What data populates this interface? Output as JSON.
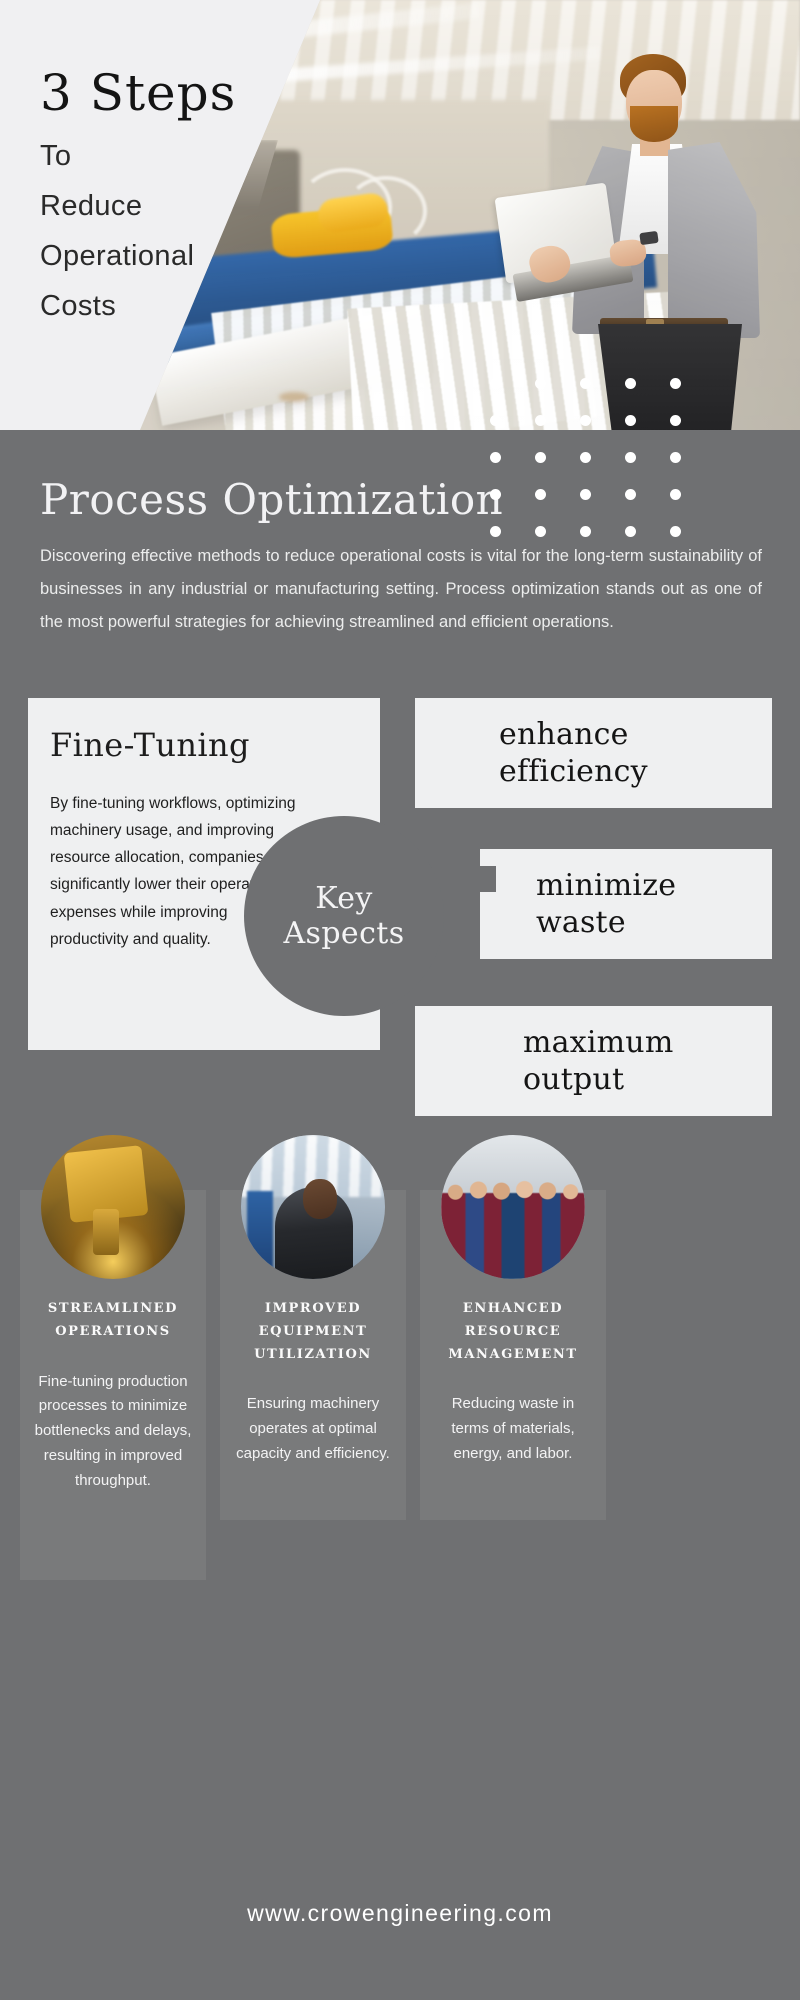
{
  "hero": {
    "title_main": "3 Steps",
    "title_lines": [
      "To",
      "Reduce",
      "Operational",
      "Costs"
    ],
    "photo_alt": "engineer-with-laptop-in-factory"
  },
  "section": {
    "title": "Process Optimization",
    "intro": "Discovering effective methods to reduce operational costs is vital for the long-term sustainability of businesses in any industrial or manufacturing setting. Process optimization stands out as one of the most powerful strategies for achieving streamlined and efficient operations."
  },
  "fine_tuning_card": {
    "title": "Fine-Tuning",
    "body": "By fine-tuning workflows, optimizing machinery usage, and improving resource allocation, companies can significantly lower their operating expenses while improving productivity and quality."
  },
  "key_circle": {
    "line1": "Key",
    "line2": "Aspects"
  },
  "aspects": [
    {
      "label": "enhance\nefficiency"
    },
    {
      "label": "minimize\nwaste"
    },
    {
      "label": "maximum\noutput"
    }
  ],
  "aspect_labels": {
    "a1_line1": "enhance",
    "a1_line2": "efficiency",
    "a2_line1": "minimize",
    "a2_line2": "waste",
    "a3_line1": "maximum",
    "a3_line2": "output"
  },
  "features": [
    {
      "title": "STREAMLINED\nOPERATIONS",
      "title_line1": "STREAMLINED",
      "title_line2": "OPERATIONS",
      "text": "Fine-tuning production processes to minimize bottlenecks and delays, resulting in improved throughput.",
      "image": "laser-cutting-machine-photo"
    },
    {
      "title": "IMPROVED\nEQUIPMENT\nUTILIZATION",
      "title_line1": "IMPROVED",
      "title_line2": "EQUIPMENT",
      "title_line3": "UTILIZATION",
      "text": "Ensuring machinery operates at optimal capacity and efficiency.",
      "image": "engineer-in-workshop-photo"
    },
    {
      "title": "ENHANCED\nRESOURCE\nMANAGEMENT",
      "title_line1": "ENHANCED",
      "title_line2": "RESOURCE",
      "title_line3": "MANAGEMENT",
      "text": "Reducing waste in terms of materials, energy, and labor.",
      "image": "team-group-photo"
    }
  ],
  "footer": {
    "url": "www.crowengineering.com"
  },
  "colors": {
    "page_light": "#f0f0f2",
    "body_gray": "#6f7072",
    "card_light": "#eff0f1",
    "text_dark": "#151515",
    "text_light": "#f3f3f4",
    "dot_white": "#ffffff"
  }
}
